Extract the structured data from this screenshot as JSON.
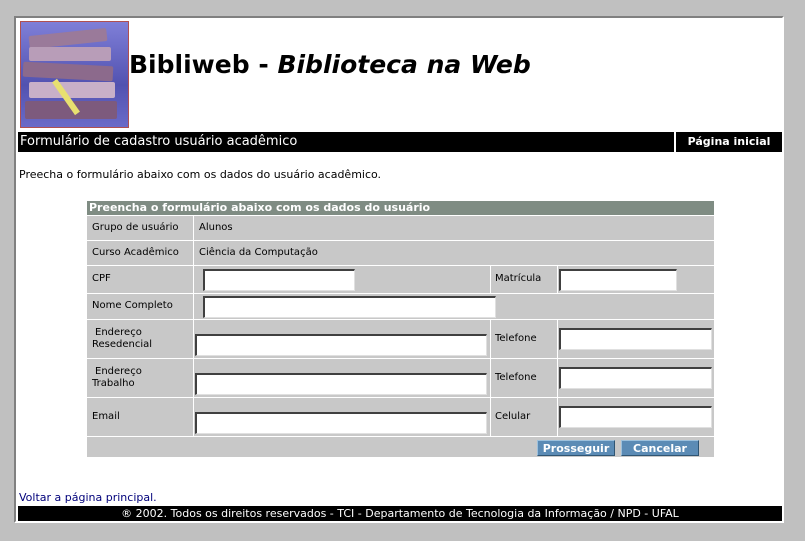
{
  "site": {
    "name": "Bibliweb",
    "separator": "-",
    "subtitle": "Biblioteca na Web"
  },
  "topbar": {
    "title": "Formulário de cadastro usuário acadêmico",
    "home_link": "Página inicial"
  },
  "intro": "Preecha o formulário abaixo com os dados do usuário acadêmico.",
  "form": {
    "header": "Preencha o formulário abaixo com os dados do usuário",
    "grupo_label": "Grupo de usuário",
    "grupo_value": "Alunos",
    "curso_label": "Curso Acadêmico",
    "curso_value": "Ciência da Computação",
    "cpf_label": "CPF",
    "cpf_value": "",
    "matricula_label": "Matrícula",
    "matricula_value": "",
    "nome_label": "Nome Completo",
    "nome_value": "",
    "end_res_label_1": "Endereço",
    "end_res_label_2": "Resedencial",
    "end_res_value": "",
    "tel1_label": "Telefone",
    "tel1_value": "",
    "end_trab_label_1": "Endereço",
    "end_trab_label_2": "Trabalho",
    "end_trab_value": "",
    "tel2_label": "Telefone",
    "tel2_value": "",
    "email_label": "Email",
    "email_value": "",
    "celular_label": "Celular",
    "celular_value": "",
    "submit_label": "Prosseguir",
    "cancel_label": "Cancelar"
  },
  "back_link": "Voltar a página principal.",
  "footer": "® 2002. Todos os direitos reservados - TCI - Departamento de Tecnologia da Informação / NPD - UFAL",
  "colors": {
    "page_bg": "#c0c0c0",
    "bar_bg": "#000000",
    "form_bg": "#c8c8c8",
    "form_header_bg": "#7f8c83",
    "button_bg": "#5b8bb5",
    "link": "#00007a"
  },
  "icons": {
    "logo": "books-logo-icon"
  }
}
